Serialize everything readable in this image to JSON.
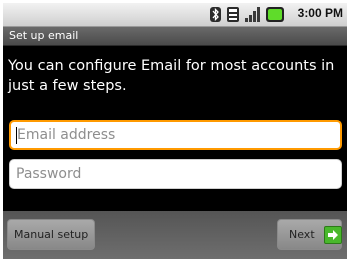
{
  "status_bar": {
    "time": "3:00 PM",
    "icons": [
      "bluetooth-icon",
      "sd-card-icon",
      "signal-icon",
      "battery-icon"
    ],
    "battery_color": "#5fdc2a"
  },
  "title_bar": {
    "title": "Set up email"
  },
  "content": {
    "instructions": "You can configure Email for most accounts in just a few steps."
  },
  "form": {
    "email": {
      "placeholder": "Email address",
      "value": ""
    },
    "password": {
      "placeholder": "Password",
      "value": ""
    },
    "focus_color": "#ff9a00"
  },
  "buttons": {
    "manual_setup": "Manual setup",
    "next": "Next",
    "next_icon": "arrow-right-icon",
    "next_icon_color": "#49b82c"
  }
}
